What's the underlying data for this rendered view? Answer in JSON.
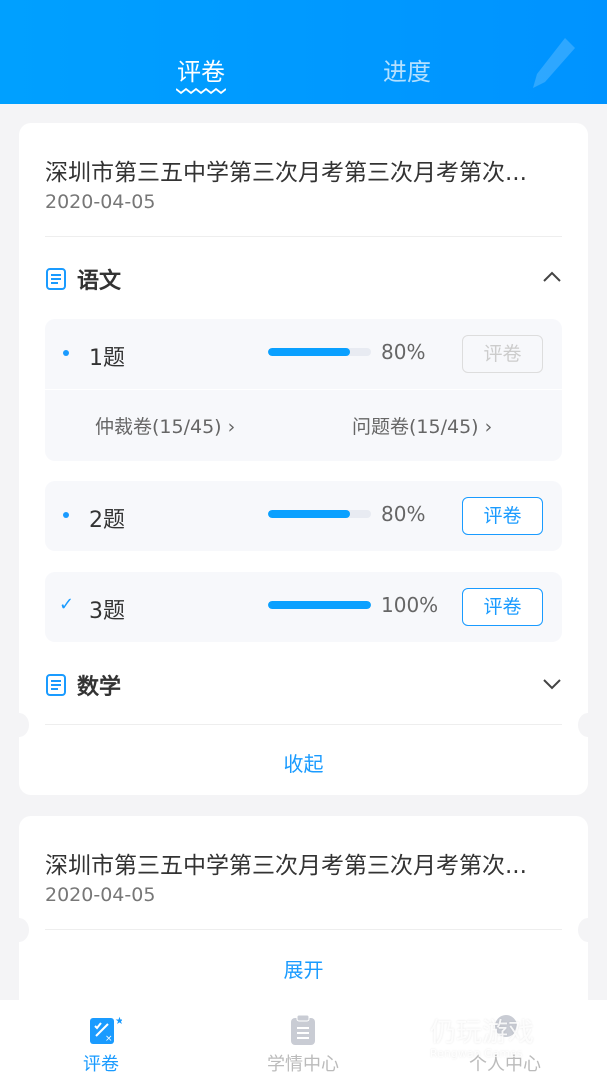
{
  "header": {
    "tabs": [
      {
        "label": "评卷",
        "active": true
      },
      {
        "label": "进度",
        "active": false
      }
    ],
    "accent": "#00a0ff"
  },
  "cards": [
    {
      "title": "深圳市第三五中学第三次月考第三次月考第次...",
      "date": "2020-04-05",
      "subjects": [
        {
          "name": "语文",
          "expanded": true,
          "questions": [
            {
              "label": "1题",
              "status": "bullet",
              "progress": 80,
              "percent": "80%",
              "button": "评卷",
              "button_disabled": true,
              "arbitration": "仲裁卷(15/45)",
              "problem": "问题卷(15/45)"
            },
            {
              "label": "2题",
              "status": "bullet",
              "progress": 80,
              "percent": "80%",
              "button": "评卷",
              "button_disabled": false
            },
            {
              "label": "3题",
              "status": "check",
              "progress": 100,
              "percent": "100%",
              "button": "评卷",
              "button_disabled": false
            }
          ]
        },
        {
          "name": "数学",
          "expanded": false
        }
      ],
      "toggle": "收起"
    },
    {
      "title": "深圳市第三五中学第三次月考第三次月考第次...",
      "date": "2020-04-05",
      "toggle": "展开"
    }
  ],
  "bottom_nav": [
    {
      "label": "评卷",
      "icon": "grading-icon",
      "active": true
    },
    {
      "label": "学情中心",
      "icon": "clipboard-icon",
      "active": false
    },
    {
      "label": "个人中心",
      "icon": "user-icon",
      "active": false
    }
  ],
  "watermark": {
    "text": "仍玩游戏",
    "sub": "Rengwan Games"
  }
}
